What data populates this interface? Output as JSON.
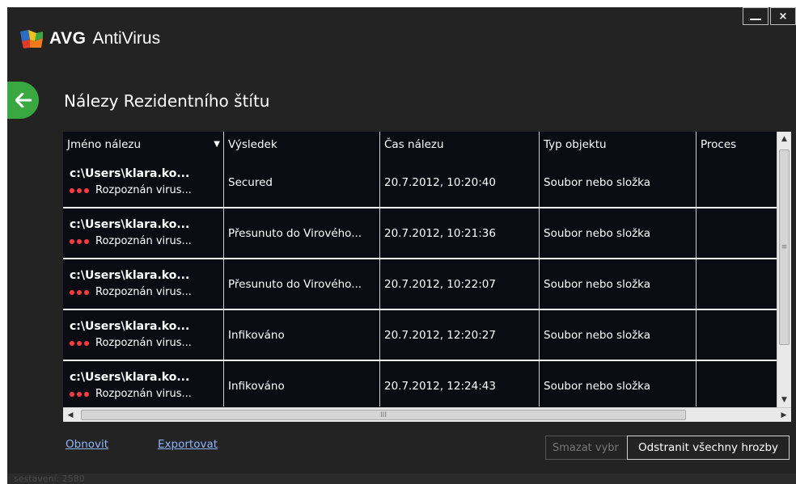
{
  "app": {
    "brand": "AVG",
    "name": "AntiVirus"
  },
  "window": {
    "minimize_icon": "minimize-icon",
    "close_label": "×"
  },
  "page": {
    "title": "Nálezy Rezidentního štítu",
    "back_icon": "arrow-left-icon"
  },
  "table": {
    "columns": [
      "Jméno nálezu",
      "Výsledek",
      "Čas nálezu",
      "Typ objektu",
      "Proces"
    ],
    "sort_indicator": "▼",
    "rows": [
      {
        "name": "c:\\Users\\klara.ko...",
        "detection": "Rozpoznán virus...",
        "result": "Secured",
        "time": "20.7.2012, 10:20:40",
        "type": "Soubor nebo složka",
        "process": ""
      },
      {
        "name": "c:\\Users\\klara.ko...",
        "detection": "Rozpoznán virus...",
        "result": "Přesunuto do Virového...",
        "time": "20.7.2012, 10:21:36",
        "type": "Soubor nebo složka",
        "process": ""
      },
      {
        "name": "c:\\Users\\klara.ko...",
        "detection": "Rozpoznán virus...",
        "result": "Přesunuto do Virového...",
        "time": "20.7.2012, 10:22:07",
        "type": "Soubor nebo složka",
        "process": ""
      },
      {
        "name": "c:\\Users\\klara.ko...",
        "detection": "Rozpoznán virus...",
        "result": "Infikováno",
        "time": "20.7.2012, 12:20:27",
        "type": "Soubor nebo složka",
        "process": ""
      },
      {
        "name": "c:\\Users\\klara.ko...",
        "detection": "Rozpoznán virus...",
        "result": "Infikováno",
        "time": "20.7.2012, 12:24:43",
        "type": "Soubor nebo složka",
        "process": ""
      }
    ],
    "severity_color": "#ff3b3b"
  },
  "footer": {
    "refresh_label": "Obnovit",
    "export_label": "Exportovat",
    "delete_selected_label": "Smazat vybr",
    "remove_all_label": "Odstranit všechny hrozby"
  },
  "status": {
    "build": "sestavení: 2580"
  }
}
